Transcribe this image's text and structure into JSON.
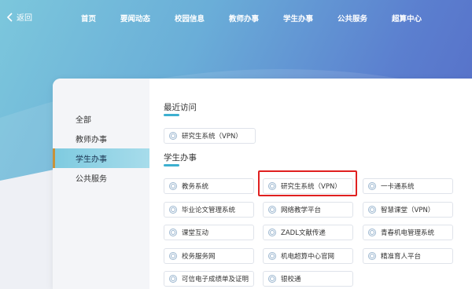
{
  "header": {
    "back_label": "返回",
    "nav": [
      "首页",
      "要闻动态",
      "校园信息",
      "教师办事",
      "学生办事",
      "公共服务",
      "超算中心"
    ]
  },
  "sidebar": {
    "items": [
      {
        "label": "全部",
        "active": false
      },
      {
        "label": "教师办事",
        "active": false
      },
      {
        "label": "学生办事",
        "active": true
      },
      {
        "label": "公共服务",
        "active": false
      }
    ]
  },
  "recent": {
    "title": "最近访问",
    "tiles": [
      "研究生系统（VPN）"
    ]
  },
  "student": {
    "title": "学生办事",
    "tiles": [
      "教务系统",
      "研究生系统（VPN）",
      "一卡通系统",
      "毕业论文管理系统",
      "网络教学平台",
      "智慧课堂（VPN）",
      "课堂互动",
      "ZADL文献传递",
      "青春机电管理系统",
      "校务服务网",
      "机电超算中心官网",
      "精准育人平台",
      "可信电子成绩单及证明",
      "银校通"
    ]
  },
  "colors": {
    "accent": "#3db0d0",
    "highlight": "#e02020",
    "active_bar": "#c7923a"
  }
}
